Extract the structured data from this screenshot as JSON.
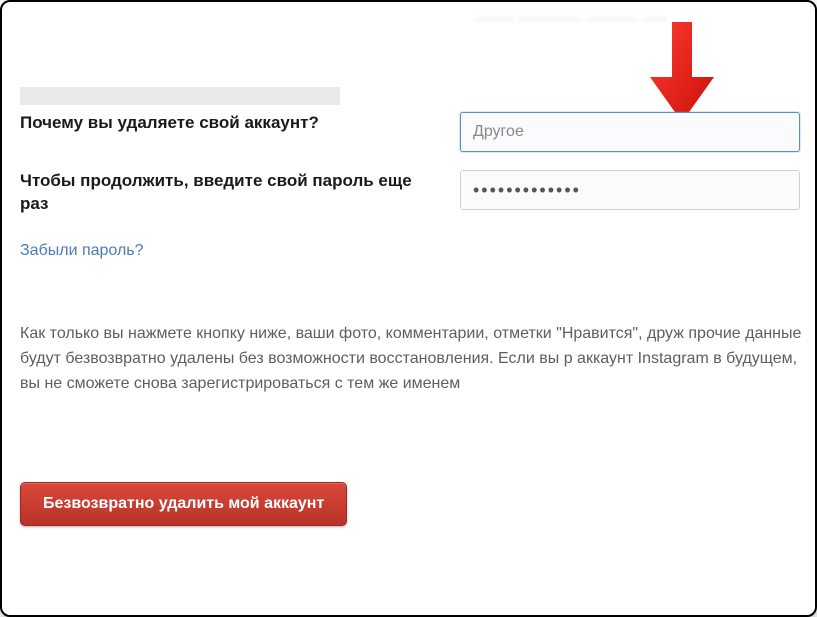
{
  "topBlur": "……… …………… ………… ……",
  "questions": {
    "reasonLabel": "Почему вы удаляете свой аккаунт?",
    "reasonValue": "Другое",
    "passwordLabel": "Чтобы продолжить, введите свой пароль еще раз",
    "passwordMask": "•••••••••••••"
  },
  "links": {
    "forgotPassword": "Забыли пароль?"
  },
  "warning": "Как только вы нажмете кнопку ниже, ваши фото, комментарии, отметки \"Нравится\", друж прочие данные будут безвозвратно удалены без возможности восстановления. Если вы р аккаунт Instagram в будущем, вы не сможете снова зарегистрироваться с тем же именем ",
  "buttons": {
    "deleteLabel": "Безвозвратно удалить мой аккаунт"
  }
}
